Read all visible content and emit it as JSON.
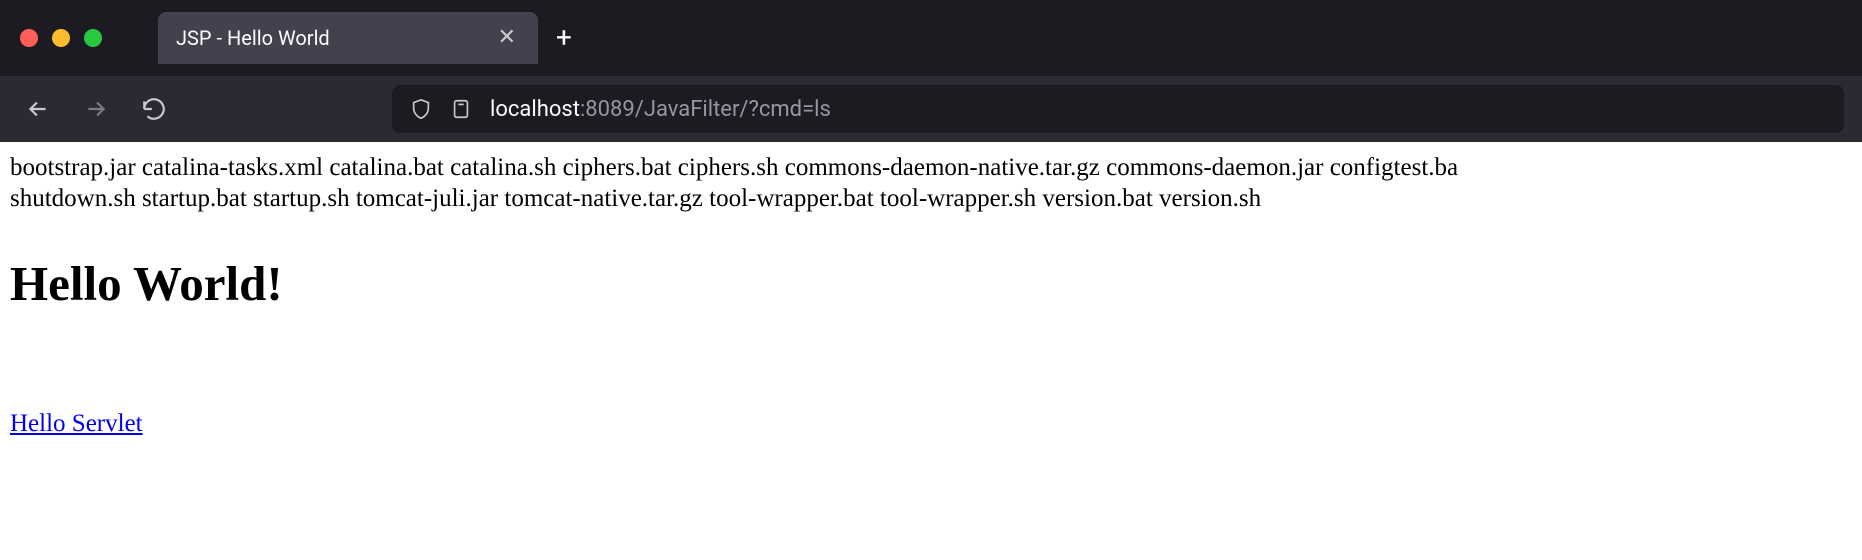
{
  "tab": {
    "title": "JSP - Hello World"
  },
  "url": {
    "host": "localhost",
    "rest": ":8089/JavaFilter/?cmd=ls"
  },
  "page": {
    "ls_line1": "bootstrap.jar catalina-tasks.xml catalina.bat catalina.sh ciphers.bat ciphers.sh commons-daemon-native.tar.gz commons-daemon.jar configtest.ba",
    "ls_line2": "shutdown.sh startup.bat startup.sh tomcat-juli.jar tomcat-native.tar.gz tool-wrapper.bat tool-wrapper.sh version.bat version.sh",
    "heading": "Hello World!",
    "link_text": "Hello Servlet"
  }
}
